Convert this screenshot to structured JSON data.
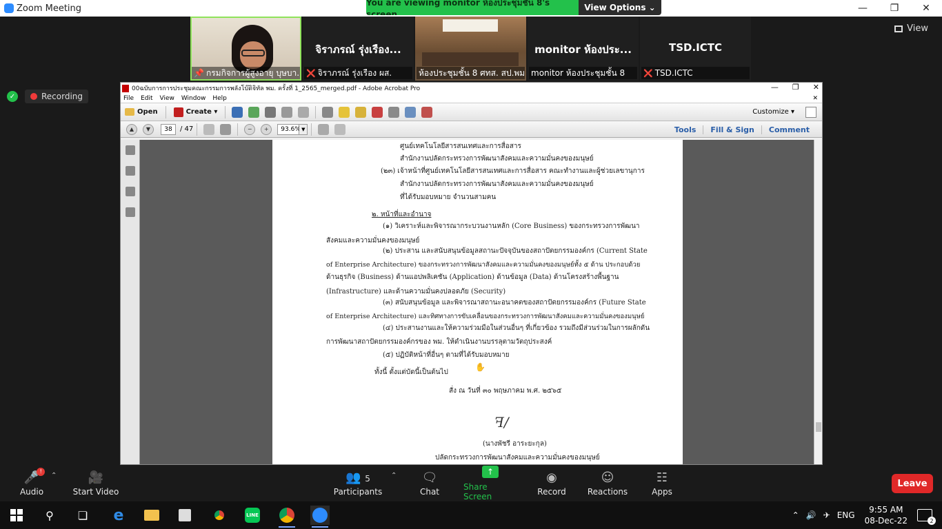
{
  "zoom": {
    "title": "Zoom Meeting",
    "share_banner": "You are viewing monitor ห้องประชุมชั้น 8's screen",
    "view_options": "View Options ⌄",
    "view_button": "View",
    "recording": "Recording"
  },
  "participants_strip": [
    {
      "label": "กรมกิจการผู้สูงอายุ บุษบา...",
      "video": true
    },
    {
      "name": "จิราภรณ์ รุ่งเรือง...",
      "label": "จิราภรณ์ รุ่งเรือง ผส.",
      "video": false,
      "muted": true
    },
    {
      "label": "ห้องประชุมชั้น 8 ศทส. สป.พม.",
      "video": true
    },
    {
      "name": "monitor ห้องประ...",
      "label": "monitor ห้องประชุมชั้น 8",
      "video": false
    },
    {
      "name": "TSD.ICTC",
      "label": "TSD.ICTC",
      "video": false,
      "muted": true
    }
  ],
  "acrobat": {
    "title": "00ฉบับการการประชุมคณะกรรมการพลังโบ๊ดิจิทัล พม. ครั้งที่ 1_2565_merged.pdf - Adobe Acrobat Pro",
    "menu": [
      "File",
      "Edit",
      "View",
      "Window",
      "Help"
    ],
    "open": "Open",
    "create": "Create ▾",
    "customize": "Customize ▾",
    "page_current": "38",
    "page_total": "/ 47",
    "zoom": "93.6%",
    "right_tools": [
      "Tools",
      "Fill & Sign",
      "Comment"
    ]
  },
  "document": {
    "lines": [
      "ศูนย์เทคโนโลยีสารสนเทศและการสื่อสาร",
      "สำนักงานปลัดกระทรวงการพัฒนาสังคมและความมั่นคงของมนุษย์",
      "(๒๓) เจ้าหน้าที่ศูนย์เทคโนโลยีสารสนเทศและการสื่อสาร        คณะทำงานและผู้ช่วยเลขานุการ",
      "สำนักงานปลัดกระทรวงการพัฒนาสังคมและความมั่นคงของมนุษย์",
      "ที่ได้รับมอบหมาย จำนวนสามคน",
      "๒. หน้าที่และอำนาจ",
      "(๑) วิเคราะห์และพิจารณากระบวนงานหลัก (Core Business) ของกระทรวงการพัฒนา",
      "สังคมและความมั่นคงของมนุษย์",
      "(๒) ประสาน และสนับสนุนข้อมูลสถานะปัจจุบันของสถาปัตยกรรมองค์กร (Current State",
      "of Enterprise Architecture) ของกระทรวงการพัฒนาสังคมและความมั่นคงของมนุษย์ทั้ง ๕ ด้าน ประกอบด้วย",
      "ด้านธุรกิจ (Business) ด้านแอปพลิเคชัน (Application) ด้านข้อมูล (Data) ด้านโครงสร้างพื้นฐาน",
      "(Infrastructure) และด้านความมั่นคงปลอดภัย (Security)",
      "(๓) สนับสนุนข้อมูล และพิจารณาสถานะอนาคตของสถาปัตยกรรมองค์กร (Future State",
      "of Enterprise Architecture) และทิศทางการขับเคลื่อนของกระทรวงการพัฒนาสังคมและความมั่นคงของมนุษย์",
      "(๔) ประสานงานและให้ความร่วมมือในส่วนอื่นๆ ที่เกี่ยวข้อง รวมถึงมีส่วนร่วมในการผลักดัน",
      "การพัฒนาสถาปัตยกรรมองค์กรของ พม. ให้ดำเนินงานบรรลุตามวัตถุประสงค์",
      "(๕) ปฏิบัติหน้าที่อื่นๆ ตามที่ได้รับมอบหมาย",
      "ทั้งนี้ ตั้งแต่บัดนี้เป็นต้นไป",
      "สั่ง ณ วันที่  ๓๐ พฤษภาคม พ.ศ. ๒๕๖๕",
      "(นางพัชรี อาระยะกุล)",
      "ปลัดกระทรวงการพัฒนาสังคมและความมั่นคงของมนุษย์"
    ]
  },
  "toolbar": {
    "audio": "Audio",
    "audio_badge": "!",
    "video": "Start Video",
    "participants": "Participants",
    "participants_count": "5",
    "chat": "Chat",
    "share": "Share Screen",
    "record": "Record",
    "reactions": "Reactions",
    "apps": "Apps",
    "leave": "Leave"
  },
  "taskbar": {
    "lang": "ENG",
    "time": "9:55 AM",
    "date": "08-Dec-22",
    "notifications": "2"
  },
  "colors": {
    "zoom_green": "#23c14b",
    "leave_red": "#e02828",
    "acrobat_link": "#2a5ea8"
  }
}
